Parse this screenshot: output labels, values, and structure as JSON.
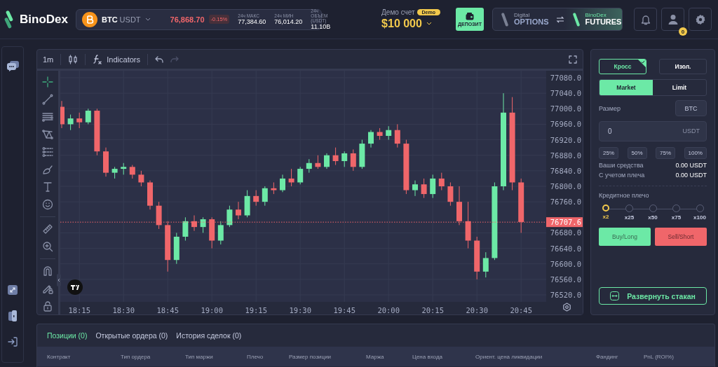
{
  "header": {
    "logo": "BinoDex",
    "ticker": {
      "symbol": "BTC",
      "quote": "USDT",
      "price": "76,868.70",
      "change": "-0.15%",
      "stats": [
        {
          "label": "24ч МАКС",
          "value": "77,384.60"
        },
        {
          "label": "24ч МИН",
          "value": "76,014.20"
        },
        {
          "label": "24ч ОБЪЁМ (USDT)",
          "value": "11.10B"
        }
      ]
    },
    "account": {
      "label": "Демо счет",
      "badge": "Demo",
      "balance": "$10 000"
    },
    "deposit_button": "ДЕПОЗИТ",
    "market_switch": [
      {
        "small": "Digital",
        "big": "OPTIONS",
        "selected": false
      },
      {
        "small": "BinoDex",
        "big": "FUTURES",
        "selected": true
      }
    ],
    "profile_badge": "0"
  },
  "chart": {
    "toolbar": {
      "interval": "1m",
      "indicators": "Indicators"
    },
    "chart_data": {
      "type": "candlestick",
      "categories": [
        null,
        null,
        "18:15",
        null,
        null,
        null,
        null,
        "18:30",
        null,
        null,
        null,
        null,
        "18:45",
        null,
        null,
        null,
        null,
        "19:00",
        null,
        null,
        null,
        null,
        "19:15",
        null,
        null,
        null,
        null,
        "19:30",
        null,
        null,
        null,
        null,
        "19:45",
        null,
        null,
        null,
        null,
        "20:00",
        null,
        null,
        null,
        null,
        "20:15",
        null,
        null,
        null,
        null,
        "20:30",
        null,
        null,
        null,
        null,
        "20:45"
      ],
      "ohlc": [
        [
          77005,
          77020,
          76950,
          76960
        ],
        [
          76960,
          76985,
          76945,
          76975
        ],
        [
          76975,
          76990,
          76950,
          76965
        ],
        [
          76965,
          77000,
          76960,
          76995
        ],
        [
          76995,
          77000,
          76880,
          76890
        ],
        [
          76890,
          76900,
          76825,
          76835
        ],
        [
          76835,
          76850,
          76820,
          76845
        ],
        [
          76845,
          76860,
          76830,
          76850
        ],
        [
          76850,
          76855,
          76820,
          76830
        ],
        [
          76830,
          76840,
          76800,
          76810
        ],
        [
          76810,
          76815,
          76740,
          76750
        ],
        [
          76750,
          76760,
          76690,
          76700
        ],
        [
          76700,
          76710,
          76580,
          76610
        ],
        [
          76610,
          76680,
          76600,
          76670
        ],
        [
          76670,
          76720,
          76660,
          76710
        ],
        [
          76710,
          76725,
          76685,
          76695
        ],
        [
          76695,
          76720,
          76680,
          76715
        ],
        [
          76715,
          76720,
          76640,
          76660
        ],
        [
          76660,
          76710,
          76650,
          76700
        ],
        [
          76700,
          76750,
          76695,
          76740
        ],
        [
          76740,
          76760,
          76715,
          76725
        ],
        [
          76725,
          76790,
          76720,
          76775
        ],
        [
          76775,
          76790,
          76750,
          76760
        ],
        [
          76760,
          76800,
          76750,
          76795
        ],
        [
          76795,
          76810,
          76780,
          76790
        ],
        [
          76790,
          76830,
          76785,
          76820
        ],
        [
          76820,
          76845,
          76800,
          76810
        ],
        [
          76810,
          76850,
          76805,
          76845
        ],
        [
          76845,
          76870,
          76835,
          76860
        ],
        [
          76860,
          76880,
          76845,
          76850
        ],
        [
          76850,
          76885,
          76845,
          76880
        ],
        [
          76880,
          76900,
          76855,
          76865
        ],
        [
          76865,
          76890,
          76850,
          76885
        ],
        [
          76885,
          76895,
          76840,
          76850
        ],
        [
          76850,
          76920,
          76845,
          76910
        ],
        [
          76910,
          76945,
          76900,
          76940
        ],
        [
          76940,
          76950,
          76920,
          76930
        ],
        [
          76930,
          76955,
          76920,
          76945
        ],
        [
          76945,
          76960,
          76900,
          76910
        ],
        [
          76910,
          76920,
          76780,
          76790
        ],
        [
          76790,
          76815,
          76775,
          76805
        ],
        [
          76805,
          76820,
          76770,
          76780
        ],
        [
          76780,
          76830,
          76770,
          76820
        ],
        [
          76820,
          76835,
          76790,
          76800
        ],
        [
          76800,
          76810,
          76750,
          76760
        ],
        [
          76760,
          76800,
          76700,
          76710
        ],
        [
          76710,
          76760,
          76640,
          76660
        ],
        [
          76660,
          76670,
          76560,
          76580
        ],
        [
          76580,
          76630,
          76565,
          76615
        ],
        [
          76615,
          76810,
          76610,
          76800
        ],
        [
          76800,
          77040,
          76790,
          76990
        ],
        [
          76990,
          77030,
          76790,
          76810
        ],
        [
          76810,
          76820,
          76680,
          76708
        ]
      ],
      "ylim": [
        76502,
        77098
      ],
      "yticks": [
        {
          "value": 77080,
          "label": "77080.0"
        },
        {
          "value": 77040,
          "label": "77040.0"
        },
        {
          "value": 77000,
          "label": "77000.0"
        },
        {
          "value": 76960,
          "label": "76960.0"
        },
        {
          "value": 76920,
          "label": "76920.0"
        },
        {
          "value": 76880,
          "label": "76880.0"
        },
        {
          "value": 76840,
          "label": "76840.0"
        },
        {
          "value": 76800,
          "label": "76800.0"
        },
        {
          "value": 76760,
          "label": "76760.0"
        },
        {
          "value": 76680,
          "label": "76680.0"
        },
        {
          "value": 76640,
          "label": "76640.0"
        },
        {
          "value": 76600,
          "label": "76600.0"
        },
        {
          "value": 76560,
          "label": "76560.0"
        },
        {
          "value": 76520,
          "label": "76520.0"
        }
      ],
      "grid": true,
      "ref_lines": [
        {
          "axis": "y",
          "value": 76707.6,
          "label": "76707.6"
        }
      ]
    }
  },
  "order_panel": {
    "margin_modes": [
      {
        "label": "Кросс",
        "selected": true
      },
      {
        "label": "Изол.",
        "selected": false
      }
    ],
    "order_types": [
      {
        "label": "Market",
        "selected": true
      },
      {
        "label": "Limit",
        "selected": false
      }
    ],
    "size_label": "Размер",
    "size_unit_button": "BTC",
    "amount_field": {
      "value": "0",
      "unit": "USDT"
    },
    "percent_buttons": [
      "25%",
      "50%",
      "75%",
      "100%"
    ],
    "funds": [
      {
        "label": "Ваши средства",
        "value": "0.00 USDT"
      },
      {
        "label": "С учетом плеча",
        "value": "0.00 USDT"
      }
    ],
    "leverage": {
      "label": "Кредитное плечо",
      "options": [
        {
          "label": "x2",
          "selected": true
        },
        {
          "label": "x25",
          "selected": false
        },
        {
          "label": "x50",
          "selected": false
        },
        {
          "label": "x75",
          "selected": false
        },
        {
          "label": "x100",
          "selected": false
        }
      ]
    },
    "buy_button": "Buy/Long",
    "sell_button": "Sell/Short",
    "expand_button": "Развернуть стакан"
  },
  "positions": {
    "tabs": [
      {
        "label": "Позиции (0)",
        "selected": true
      },
      {
        "label": "Открытые ордера (0)",
        "selected": false
      },
      {
        "label": "История сделок (0)",
        "selected": false
      }
    ],
    "columns": [
      "Контракт",
      "Тип ордера",
      "Тип маржи",
      "Плечо",
      "Размер позиции",
      "Маржа",
      "Цена входа",
      "Ориент. цена ликвидации",
      "Фандинг",
      "PnL (ROI%)"
    ]
  }
}
